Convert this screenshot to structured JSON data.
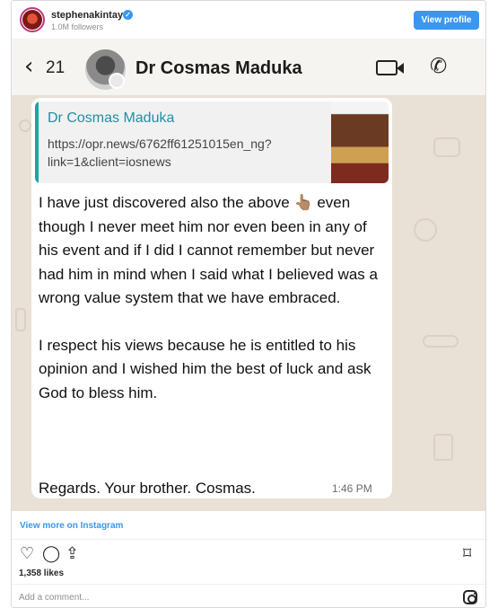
{
  "header": {
    "username": "stephenakintayo",
    "followers": "1.0M followers",
    "view_profile": "View profile",
    "verified_icon": "verified-badge-icon"
  },
  "screenshot": {
    "back_icon": "chevron-left-icon",
    "unread_count": "21",
    "contact_name": "Dr Cosmas Maduka",
    "video_icon": "video-camera-icon",
    "phone_icon": "phone-icon",
    "quoted": {
      "name": "Dr Cosmas Maduka",
      "link": "https://opr.news/6762ff61251015en_ng?link=1&client=iosnews"
    },
    "message": {
      "para1": "I have just discovered also the above 👆🏽 even though I never meet him nor even been in any of his event and if I did I cannot remember but never had him in mind when I said what I believed was a wrong value system that we have embraced.",
      "para2": "I respect his views because he is entitled to his opinion and I wished him the best of luck and ask God to bless him.",
      "signoff": "Regards. Your brother. Cosmas.",
      "time": "1:46 PM"
    }
  },
  "footer": {
    "view_more": "View more on Instagram",
    "likes": "1,358 likes",
    "comment_placeholder": "Add a comment...",
    "icons": [
      "heart-icon",
      "comment-icon",
      "share-icon",
      "bookmark-icon",
      "instagram-icon"
    ]
  },
  "colors": {
    "accent": "#3897f0",
    "quote_bar": "#1fa5a0",
    "chat_bg": "#e9e0d6"
  }
}
